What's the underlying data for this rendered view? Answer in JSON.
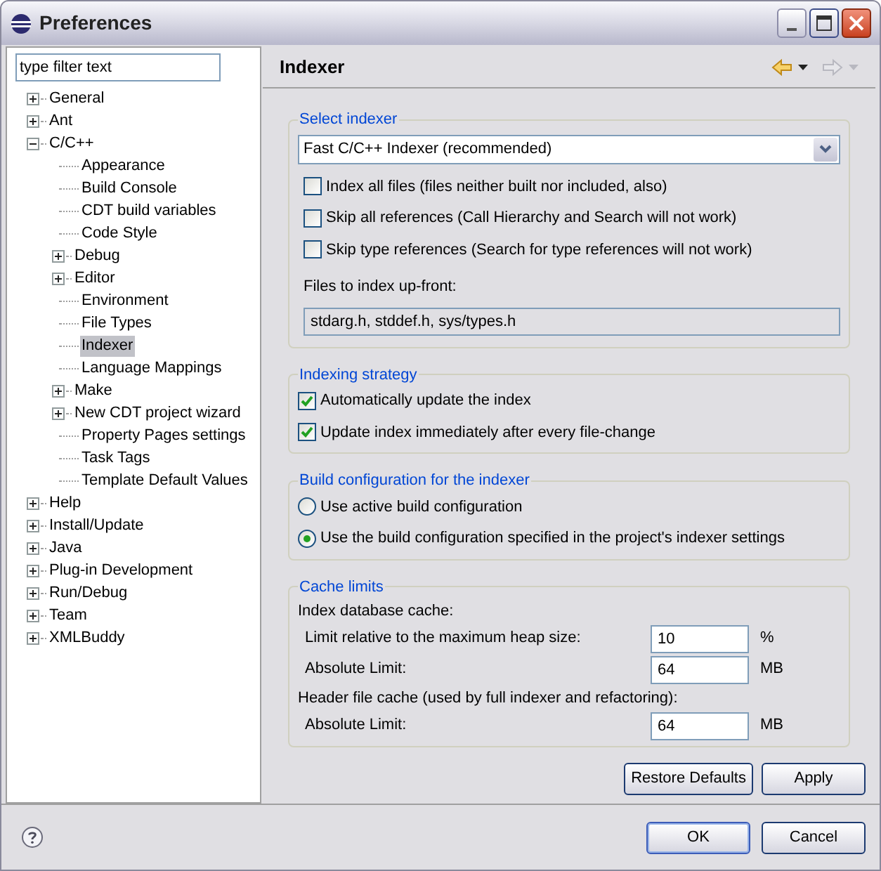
{
  "window": {
    "title": "Preferences"
  },
  "filter": {
    "value": "type filter text"
  },
  "tree": [
    {
      "label": "General",
      "kind": "folder",
      "expanded": false,
      "selected": false
    },
    {
      "label": "Ant",
      "kind": "folder",
      "expanded": false,
      "selected": false
    },
    {
      "label": "C/C++",
      "kind": "folder",
      "expanded": true,
      "selected": false,
      "children": [
        {
          "label": "Appearance",
          "kind": "leaf",
          "selected": false
        },
        {
          "label": "Build Console",
          "kind": "leaf",
          "selected": false
        },
        {
          "label": "CDT build variables",
          "kind": "leaf",
          "selected": false
        },
        {
          "label": "Code Style",
          "kind": "leaf",
          "selected": false
        },
        {
          "label": "Debug",
          "kind": "folder",
          "expanded": false,
          "selected": false
        },
        {
          "label": "Editor",
          "kind": "folder",
          "expanded": false,
          "selected": false
        },
        {
          "label": "Environment",
          "kind": "leaf",
          "selected": false
        },
        {
          "label": "File Types",
          "kind": "leaf",
          "selected": false
        },
        {
          "label": "Indexer",
          "kind": "leaf",
          "selected": true
        },
        {
          "label": "Language Mappings",
          "kind": "leaf",
          "selected": false
        },
        {
          "label": "Make",
          "kind": "folder",
          "expanded": false,
          "selected": false
        },
        {
          "label": "New CDT project wizard",
          "kind": "folder",
          "expanded": false,
          "selected": false
        },
        {
          "label": "Property Pages settings",
          "kind": "leaf",
          "selected": false
        },
        {
          "label": "Task Tags",
          "kind": "leaf",
          "selected": false
        },
        {
          "label": "Template Default Values",
          "kind": "leaf",
          "selected": false
        }
      ]
    },
    {
      "label": "Help",
      "kind": "folder",
      "expanded": false,
      "selected": false
    },
    {
      "label": "Install/Update",
      "kind": "folder",
      "expanded": false,
      "selected": false
    },
    {
      "label": "Java",
      "kind": "folder",
      "expanded": false,
      "selected": false
    },
    {
      "label": "Plug-in Development",
      "kind": "folder",
      "expanded": false,
      "selected": false
    },
    {
      "label": "Run/Debug",
      "kind": "folder",
      "expanded": false,
      "selected": false
    },
    {
      "label": "Team",
      "kind": "folder",
      "expanded": false,
      "selected": false
    },
    {
      "label": "XMLBuddy",
      "kind": "folder",
      "expanded": false,
      "selected": false
    }
  ],
  "page": {
    "title": "Indexer",
    "back_enabled": true,
    "forward_enabled": false
  },
  "select_indexer": {
    "title": "Select indexer",
    "dropdown": "Fast C/C++ Indexer (recommended)",
    "options": [
      {
        "label": "Index all files (files neither built nor included, also)",
        "checked": false
      },
      {
        "label": "Skip all references (Call Hierarchy and Search will not work)",
        "checked": false
      },
      {
        "label": "Skip type references (Search for type references will not work)",
        "checked": false
      }
    ],
    "files_label": "Files to index up-front:",
    "files_value": "stdarg.h, stddef.h, sys/types.h"
  },
  "indexing_strategy": {
    "title": "Indexing strategy",
    "options": [
      {
        "label": "Automatically update the index",
        "checked": true
      },
      {
        "label": "Update index immediately after every file-change",
        "checked": true
      }
    ]
  },
  "build_configuration": {
    "title": "Build configuration for the indexer",
    "choices": [
      {
        "label": "Use active build configuration",
        "selected": false
      },
      {
        "label": "Use the build configuration specified in the project's indexer settings",
        "selected": true
      }
    ]
  },
  "cache_limits": {
    "title": "Cache limits",
    "rows": [
      {
        "kind": "heading",
        "label": "Index database cache:"
      },
      {
        "kind": "field",
        "label": "Limit relative to the maximum heap size:",
        "value": "10",
        "unit": "%"
      },
      {
        "kind": "field",
        "label": "Absolute Limit:",
        "value": "64",
        "unit": "MB"
      },
      {
        "kind": "heading",
        "label": "Header file cache (used by full indexer and refactoring):"
      },
      {
        "kind": "field",
        "label": "Absolute Limit:",
        "value": "64",
        "unit": "MB"
      }
    ]
  },
  "page_buttons": [
    "Restore Defaults",
    "Apply"
  ],
  "dialog_buttons": [
    {
      "label": "OK",
      "default": true
    },
    {
      "label": "Cancel",
      "default": false
    }
  ]
}
